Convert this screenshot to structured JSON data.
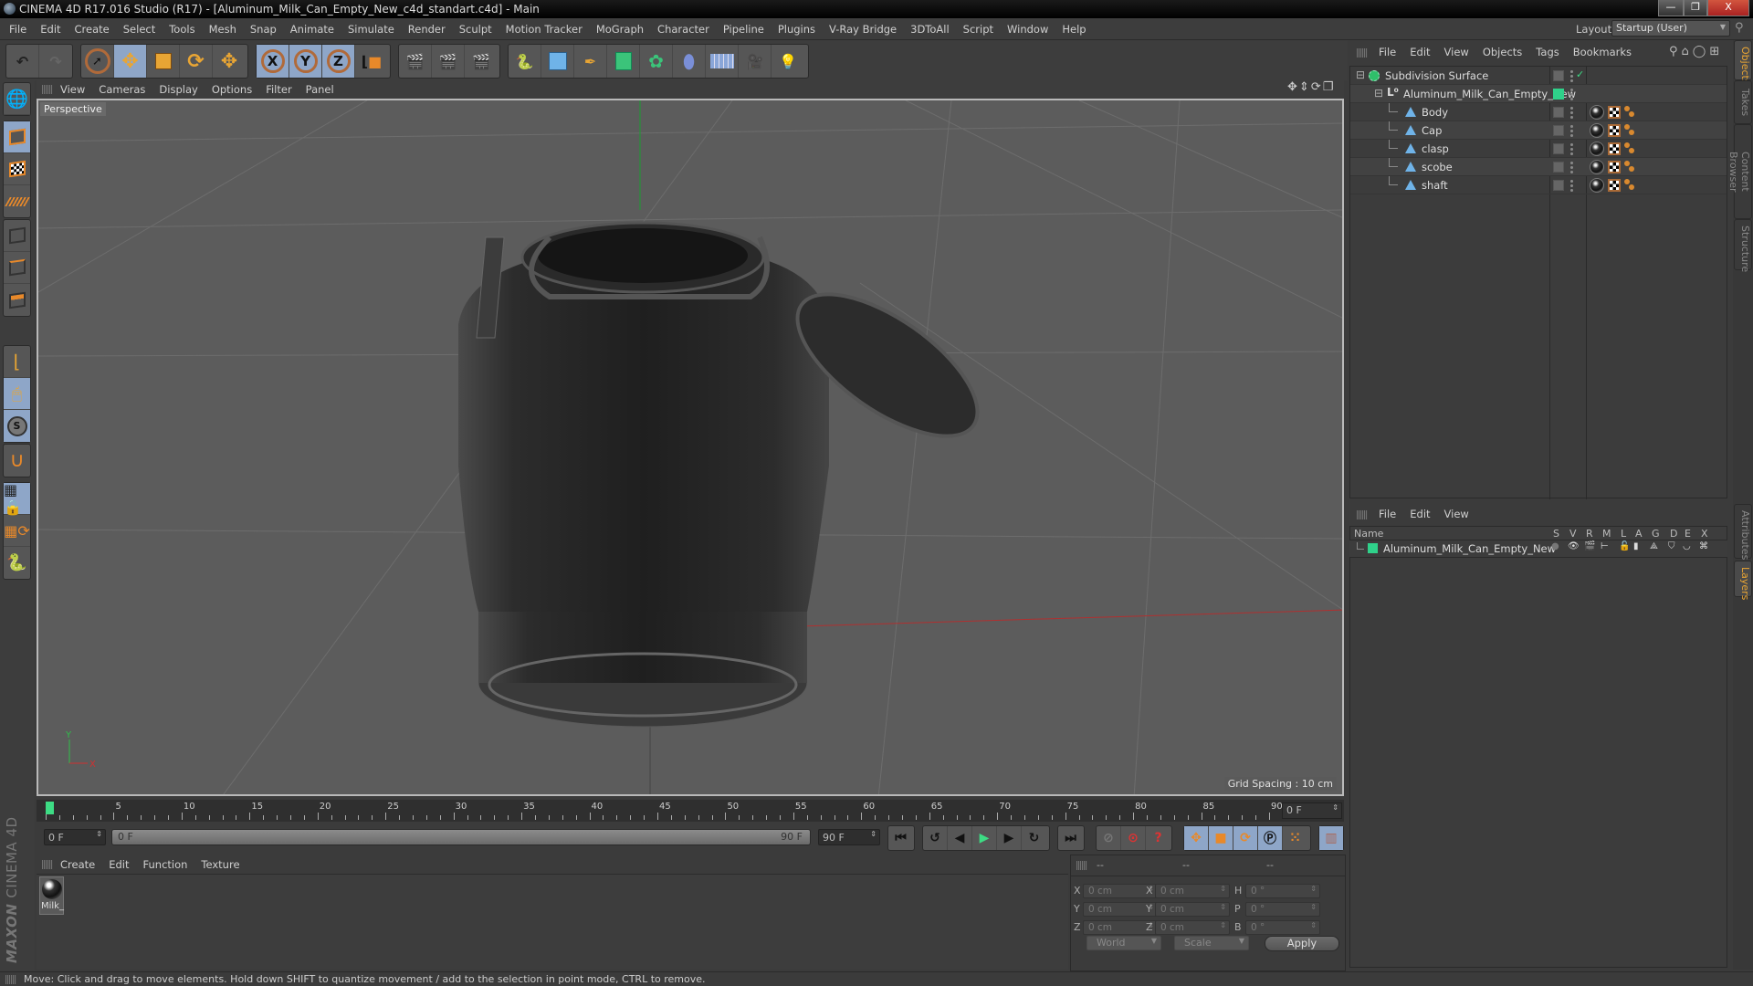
{
  "window": {
    "title": "CINEMA 4D R17.016 Studio (R17) - [Aluminum_Milk_Can_Empty_New_c4d_standart.c4d] - Main",
    "controls": [
      "minimize",
      "restore",
      "close"
    ]
  },
  "menubar": {
    "items": [
      "File",
      "Edit",
      "Create",
      "Select",
      "Tools",
      "Mesh",
      "Snap",
      "Animate",
      "Simulate",
      "Render",
      "Sculpt",
      "Motion Tracker",
      "MoGraph",
      "Character",
      "Pipeline",
      "Plugins",
      "V-Ray Bridge",
      "3DToAll",
      "Script",
      "Window",
      "Help"
    ],
    "layout_label": "Layout:",
    "layout_value": "Startup (User)"
  },
  "toolbar": {
    "groups": [
      [
        "undo-icon",
        "redo-icon"
      ],
      [
        "select-arrow-icon",
        "move-icon",
        "scale-icon",
        "rotate-icon",
        "recent-tool-icon"
      ],
      [
        "x-axis-lock",
        "y-axis-lock",
        "z-axis-lock",
        "coordinate-system-icon"
      ],
      [
        "render-view-icon",
        "render-picture-viewer-icon",
        "render-settings-icon"
      ],
      [
        "python-icon",
        "cube-primitive-icon",
        "pen-spline-icon",
        "subdivision-icon",
        "array-icon",
        "deformer-icon",
        "floor-icon",
        "camera-icon",
        "light-icon"
      ]
    ],
    "axis_labels": [
      "X",
      "Y",
      "Z"
    ]
  },
  "left_tools": [
    "viewport-solo-icon",
    "model-mode-icon",
    "texture-mode-icon",
    "workplane-icon",
    "points-mode-icon",
    "edges-mode-icon",
    "polygons-mode-icon",
    "axis-mode-icon",
    "tweak-mode-icon",
    "snap-icon",
    "magnet-icon",
    "lock-workplane-icon",
    "workplane-rotate-icon",
    "python-script-icon"
  ],
  "viewport": {
    "menu": [
      "View",
      "Cameras",
      "Display",
      "Options",
      "Filter",
      "Panel"
    ],
    "camera_label": "Perspective",
    "grid_spacing": "Grid Spacing : 10 cm",
    "axis_x": "X",
    "axis_y": "Y"
  },
  "timeline": {
    "ticks": [
      "0",
      "5",
      "10",
      "15",
      "20",
      "25",
      "30",
      "35",
      "40",
      "45",
      "50",
      "55",
      "60",
      "65",
      "70",
      "75",
      "80",
      "85",
      "90"
    ],
    "current_frame": "0 F",
    "start_field": "0 F",
    "range_start": "0 F",
    "range_end": "90 F",
    "end_field": "90 F",
    "playhead_frame": 0,
    "max_frame": 90
  },
  "playback": {
    "buttons": [
      "go-to-start",
      "previous-key",
      "previous-frame",
      "play",
      "next-frame",
      "next-key",
      "go-to-end"
    ],
    "key_buttons": [
      "record-disabled",
      "autokey",
      "keyframe-selection"
    ],
    "key_tracks": [
      "position-track",
      "scale-track",
      "rotation-track",
      "parameter-track",
      "point-level-animation"
    ],
    "timeline_button": "open-timeline"
  },
  "materials": {
    "menu": [
      "Create",
      "Edit",
      "Function",
      "Texture"
    ],
    "items": [
      {
        "name": "Milk_"
      }
    ]
  },
  "branding": {
    "maxon": "MAXON",
    "product": "CINEMA 4D"
  },
  "coordinates": {
    "headers": [
      "--",
      "--",
      "--"
    ],
    "rows": [
      {
        "l1": "X",
        "v1": "0 cm",
        "l2": "X",
        "v2": "0 cm",
        "l3": "H",
        "v3": "0 °"
      },
      {
        "l1": "Y",
        "v1": "0 cm",
        "l2": "Y",
        "v2": "0 cm",
        "l3": "P",
        "v3": "0 °"
      },
      {
        "l1": "Z",
        "v1": "0 cm",
        "l2": "Z",
        "v2": "0 cm",
        "l3": "B",
        "v3": "0 °"
      }
    ],
    "space_dropdown": "World",
    "mode_dropdown": "Scale",
    "apply_label": "Apply"
  },
  "status": {
    "text": "Move: Click and drag to move elements. Hold down SHIFT to quantize movement / add to the selection in point mode, CTRL to remove."
  },
  "objects_panel": {
    "menu": [
      "File",
      "Edit",
      "View",
      "Objects",
      "Tags",
      "Bookmarks"
    ],
    "tree": [
      {
        "name": "Subdivision Surface",
        "type": "subdivision",
        "depth": 0,
        "enabled_check": true
      },
      {
        "name": "Aluminum_Milk_Can_Empty_New",
        "type": "null",
        "depth": 1,
        "layer_color": "#2fd18a"
      },
      {
        "name": "Body",
        "type": "polygon",
        "depth": 2,
        "tags": [
          "material",
          "texture-uvw",
          "phong"
        ]
      },
      {
        "name": "Cap",
        "type": "polygon",
        "depth": 2,
        "tags": [
          "material",
          "texture-uvw",
          "phong"
        ]
      },
      {
        "name": "clasp",
        "type": "polygon",
        "depth": 2,
        "tags": [
          "material",
          "texture-uvw",
          "phong"
        ]
      },
      {
        "name": "scobe",
        "type": "polygon",
        "depth": 2,
        "tags": [
          "material",
          "texture-uvw",
          "phong"
        ]
      },
      {
        "name": "shaft",
        "type": "polygon",
        "depth": 2,
        "tags": [
          "material",
          "texture-uvw",
          "phong"
        ]
      }
    ]
  },
  "layers_panel": {
    "menu": [
      "File",
      "Edit",
      "View"
    ],
    "columns": [
      "Name",
      "S",
      "V",
      "R",
      "M",
      "L",
      "A",
      "G",
      "D",
      "E",
      "X"
    ],
    "rows": [
      {
        "name": "Aluminum_Milk_Can_Empty_New",
        "color": "#2fd18a"
      }
    ]
  },
  "side_tabs": {
    "top": [
      {
        "label": "Objects",
        "active": true
      },
      {
        "label": "Takes"
      },
      {
        "label": "Content Browser"
      },
      {
        "label": "Structure"
      }
    ],
    "bottom": [
      {
        "label": "Attributes"
      },
      {
        "label": "Layers",
        "active": true
      }
    ]
  },
  "colors": {
    "accent_orange": "#e8a534",
    "selection_blue": "#8ea6c8",
    "layer_green": "#2fd18a",
    "playhead_green": "#3ddc84"
  }
}
